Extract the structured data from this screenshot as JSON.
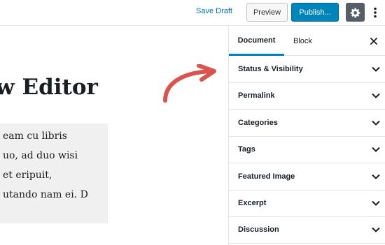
{
  "toolbar": {
    "save_draft": "Save Draft",
    "preview": "Preview",
    "publish": "Publish...",
    "settings_icon": "gear-icon",
    "more_icon": "vertical-ellipsis-icon"
  },
  "editor": {
    "title": "w Editor",
    "paragraph_lines": [
      "eam cu libris",
      "uo, ad duo wisi",
      "et eripuit,",
      "utando nam ei. D"
    ],
    "annotation_icon": "curved-arrow-icon"
  },
  "sidebar": {
    "tabs": [
      {
        "label": "Document",
        "active": true
      },
      {
        "label": "Block",
        "active": false
      }
    ],
    "close_icon": "close-icon",
    "panels": [
      {
        "label": "Status & Visibility"
      },
      {
        "label": "Permalink"
      },
      {
        "label": "Categories"
      },
      {
        "label": "Tags"
      },
      {
        "label": "Featured Image"
      },
      {
        "label": "Excerpt"
      },
      {
        "label": "Discussion"
      }
    ]
  },
  "colors": {
    "accent": "#0085ba",
    "link": "#0073aa",
    "settings_bg": "#555d66",
    "annotation": "#d9534f"
  }
}
